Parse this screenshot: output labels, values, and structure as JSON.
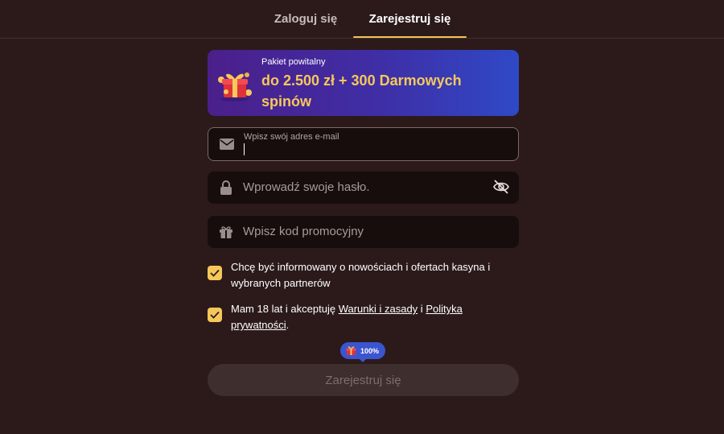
{
  "tabs": {
    "login_label": "Zaloguj się",
    "register_label": "Zarejestruj się",
    "active": "register"
  },
  "banner": {
    "label": "Pakiet powitalny",
    "title": "do 2.500 zł + 300 Darmowych spinów",
    "icon": "gift-icon"
  },
  "form": {
    "email": {
      "label": "Wpisz swój adres e-mail",
      "value": "",
      "icon": "envelope-icon"
    },
    "password": {
      "placeholder": "Wprowadź swoje hasło.",
      "icon": "lock-icon",
      "toggle_icon": "eye-off-icon"
    },
    "promo": {
      "placeholder": "Wpisz kod promocyjny",
      "icon": "gift-icon"
    },
    "consent_marketing": {
      "checked": true,
      "text": "Chcę być informowany o nowościach i ofertach kasyna i wybranych partnerów"
    },
    "consent_terms": {
      "checked": true,
      "text_before": "Mam 18 lat i akceptuję ",
      "terms_link": "Warunki i zasady",
      "text_middle": " i ",
      "privacy_link": "Polityka prywatności",
      "text_after": "."
    },
    "bonus_badge": {
      "value": "100%",
      "icon": "gift-icon"
    },
    "submit_label": "Zarejestruj się"
  },
  "colors": {
    "background": "#2c1a1b",
    "accent": "#f6c85a",
    "field_bg": "#170d0d",
    "badge": "#3b55d1"
  }
}
